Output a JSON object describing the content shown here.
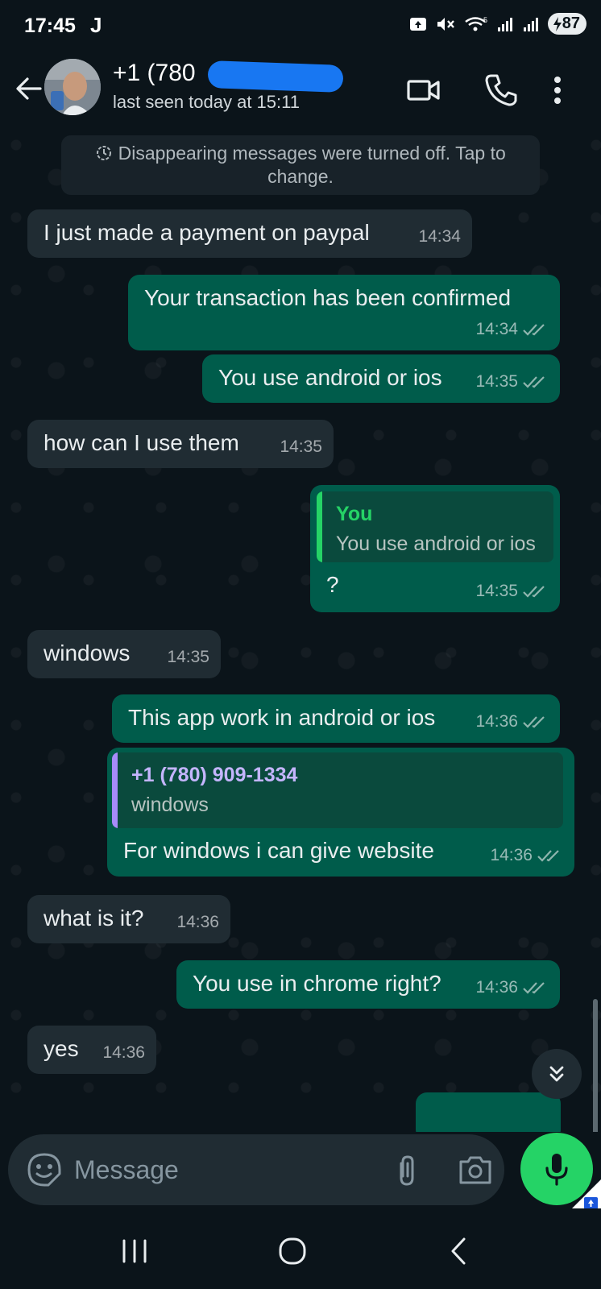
{
  "status_bar": {
    "time": "17:45",
    "app_letter": "J",
    "network": "5",
    "battery": "87"
  },
  "header": {
    "contact_name": "+1 (780",
    "last_seen": "last seen today at 15:11"
  },
  "system_message": "Disappearing messages were turned off. Tap to change.",
  "messages": [
    {
      "dir": "in",
      "text": "I just made a payment on paypal",
      "time": "14:34"
    },
    {
      "dir": "out",
      "text": "Your transaction has been confirmed",
      "time": "14:34"
    },
    {
      "dir": "out",
      "text": "You use android or ios",
      "time": "14:35"
    },
    {
      "dir": "in",
      "text": "how can I use them",
      "time": "14:35"
    },
    {
      "dir": "out",
      "quote_author": "You",
      "quote_text": "You use android or ios",
      "text": "?",
      "time": "14:35"
    },
    {
      "dir": "in",
      "text": "windows",
      "time": "14:35"
    },
    {
      "dir": "out",
      "text": "This app work in android or ios",
      "time": "14:36"
    },
    {
      "dir": "out",
      "quote_author": "+1 (780) 909-1334",
      "quote_text": "windows",
      "text": "For windows i can give website",
      "time": "14:36"
    },
    {
      "dir": "in",
      "text": "what is it?",
      "time": "14:36"
    },
    {
      "dir": "out",
      "text": "You use in chrome right?",
      "time": "14:36"
    },
    {
      "dir": "in",
      "text": "yes",
      "time": "14:36"
    }
  ],
  "input": {
    "placeholder": "Message"
  },
  "colors": {
    "outgoing": "#005c4b",
    "incoming": "#202c33",
    "accent_green": "#25d366",
    "read_ticks": "#8fb5ae",
    "quote_you": "#25d366",
    "quote_contact": "#a78bfa"
  }
}
